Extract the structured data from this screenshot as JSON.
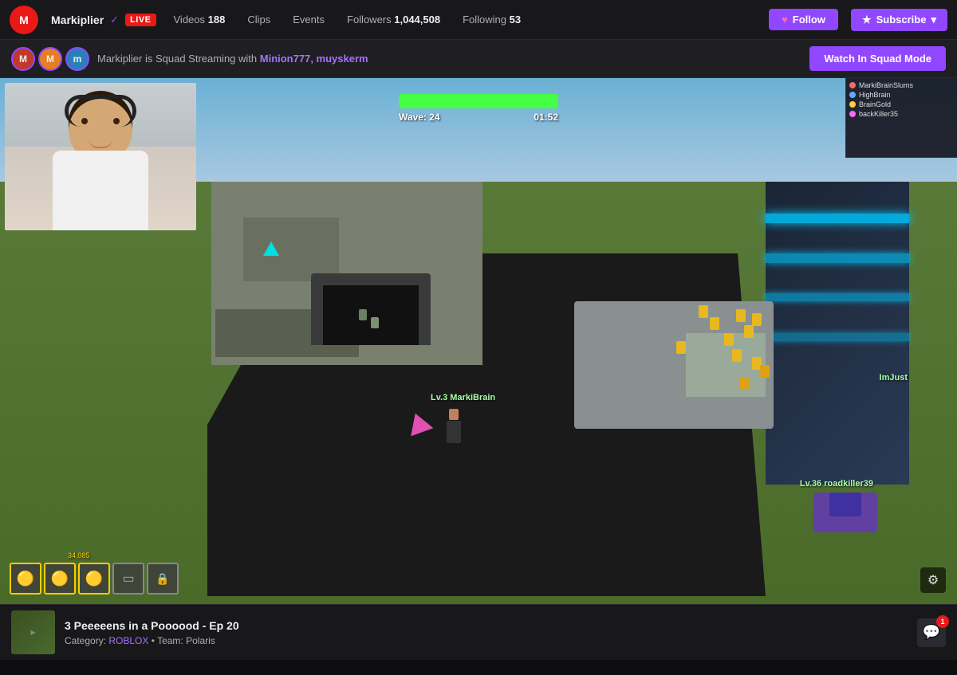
{
  "nav": {
    "channel_name": "Markiplier",
    "live_label": "LIVE",
    "videos_label": "Videos",
    "videos_count": "188",
    "clips_label": "Clips",
    "events_label": "Events",
    "followers_label": "Followers",
    "followers_count": "1,044,508",
    "following_label": "Following",
    "following_count": "53",
    "follow_button": "Follow",
    "subscribe_button": "Subscribe"
  },
  "squad_bar": {
    "text_prefix": "Markiplier is Squad Streaming with ",
    "streamers": "Minion777, muyskerm",
    "button_label": "Watch In Squad Mode"
  },
  "game": {
    "wave_label": "Wave: 24",
    "timer": "01:52",
    "health_percent": 100,
    "player1_label": "MarkiBrain",
    "player1_level": "Lv.3",
    "player2_label": "roadkiller39",
    "player2_level": "Lv.36",
    "player3_label": "ImJust",
    "inventory_count": "34,085"
  },
  "mini_map": {
    "players": [
      {
        "name": "MarkiBrainSlums",
        "color": "#ff6666"
      },
      {
        "name": "HighBrain",
        "color": "#66aaff"
      },
      {
        "name": "BrainGold",
        "color": "#ffcc44"
      },
      {
        "name": "backKiller35",
        "color": "#ff66ff"
      }
    ]
  },
  "bottom_bar": {
    "stream_title": "3 Peeeeens in a Poooood - Ep 20",
    "category_prefix": "Category:",
    "category": "ROBLOX",
    "team_prefix": "Team:",
    "team": "Polaris",
    "chat_badge": "1"
  },
  "icons": {
    "heart": "♥",
    "star": "★",
    "gear": "⚙",
    "chat": "💬",
    "chevron": "▾",
    "verified": "✓"
  }
}
